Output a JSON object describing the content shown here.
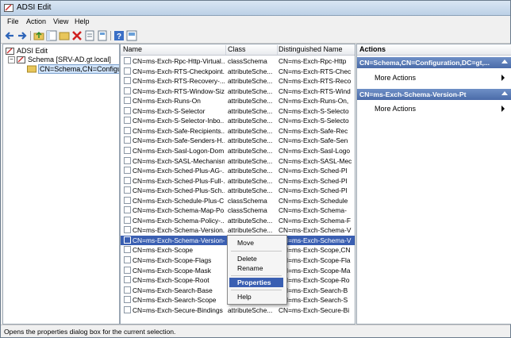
{
  "window": {
    "title": "ADSI Edit"
  },
  "menu": [
    "File",
    "Action",
    "View",
    "Help"
  ],
  "toolbar_icons": [
    "back-icon",
    "forward-icon",
    "up-folder-icon",
    "show-tree-icon",
    "delete-icon",
    "export-icon",
    "properties-icon",
    "help-icon",
    "console-icon"
  ],
  "tree": {
    "root": "ADSI Edit",
    "schema": "Schema [SRV-AD.gt.local]",
    "child": "CN=Schema,CN=Configura"
  },
  "list": {
    "headers": [
      "Name",
      "Class",
      "Distinguished Name"
    ],
    "rows": [
      {
        "name": "CN=ms-Exch-Rpc-Http-Virtual...",
        "class": "classSchema",
        "dn": "CN=ms-Exch-Rpc-Http"
      },
      {
        "name": "CN=ms-Exch-RTS-Checkpoint...",
        "class": "attributeSche...",
        "dn": "CN=ms-Exch-RTS-Chec"
      },
      {
        "name": "CN=ms-Exch-RTS-Recovery-...",
        "class": "attributeSche...",
        "dn": "CN=ms-Exch-RTS-Reco"
      },
      {
        "name": "CN=ms-Exch-RTS-Window-Size",
        "class": "attributeSche...",
        "dn": "CN=ms-Exch-RTS-Wind"
      },
      {
        "name": "CN=ms-Exch-Runs-On",
        "class": "attributeSche...",
        "dn": "CN=ms-Exch-Runs-On,"
      },
      {
        "name": "CN=ms-Exch-S-Selector",
        "class": "attributeSche...",
        "dn": "CN=ms-Exch-S-Selecto"
      },
      {
        "name": "CN=ms-Exch-S-Selector-Inbo...",
        "class": "attributeSche...",
        "dn": "CN=ms-Exch-S-Selecto"
      },
      {
        "name": "CN=ms-Exch-Safe-Recipients...",
        "class": "attributeSche...",
        "dn": "CN=ms-Exch-Safe-Rec"
      },
      {
        "name": "CN=ms-Exch-Safe-Senders-H...",
        "class": "attributeSche...",
        "dn": "CN=ms-Exch-Safe-Sen"
      },
      {
        "name": "CN=ms-Exch-Sasl-Logon-Dom...",
        "class": "attributeSche...",
        "dn": "CN=ms-Exch-Sasl-Logo"
      },
      {
        "name": "CN=ms-Exch-SASL-Mechanisms",
        "class": "attributeSche...",
        "dn": "CN=ms-Exch-SASL-Mec"
      },
      {
        "name": "CN=ms-Exch-Sched-Plus-AG-...",
        "class": "attributeSche...",
        "dn": "CN=ms-Exch-Sched-Pl"
      },
      {
        "name": "CN=ms-Exch-Sched-Plus-Full-...",
        "class": "attributeSche...",
        "dn": "CN=ms-Exch-Sched-Pl"
      },
      {
        "name": "CN=ms-Exch-Sched-Plus-Sch...",
        "class": "attributeSche...",
        "dn": "CN=ms-Exch-Sched-Pl"
      },
      {
        "name": "CN=ms-Exch-Schedule-Plus-C...",
        "class": "classSchema",
        "dn": "CN=ms-Exch-Schedule"
      },
      {
        "name": "CN=ms-Exch-Schema-Map-Po...",
        "class": "classSchema",
        "dn": "CN=ms-Exch-Schema-"
      },
      {
        "name": "CN=ms-Exch-Schema-Policy-...",
        "class": "attributeSche...",
        "dn": "CN=ms-Exch-Schema-F"
      },
      {
        "name": "CN=ms-Exch-Schema-Version...",
        "class": "attributeSche...",
        "dn": "CN=ms-Exch-Schema-V"
      },
      {
        "name": "CN=ms-Exch-Schema-Version-Pt",
        "class": "attributeSche...",
        "dn": "CN=ms-Exch-Schema-V"
      },
      {
        "name": "CN=ms-Exch-Scope",
        "class": "attributeSche...",
        "dn": "CN=ms-Exch-Scope,CN"
      },
      {
        "name": "CN=ms-Exch-Scope-Flags",
        "class": "attributeSche...",
        "dn": "CN=ms-Exch-Scope-Fla"
      },
      {
        "name": "CN=ms-Exch-Scope-Mask",
        "class": "attributeSche...",
        "dn": "CN=ms-Exch-Scope-Ma"
      },
      {
        "name": "CN=ms-Exch-Scope-Root",
        "class": "attributeSche...",
        "dn": "CN=ms-Exch-Scope-Ro"
      },
      {
        "name": "CN=ms-Exch-Search-Base",
        "class": "attributeSche...",
        "dn": "CN=ms-Exch-Search-B"
      },
      {
        "name": "CN=ms-Exch-Search-Scope",
        "class": "attributeSche...",
        "dn": "CN=ms-Exch-Search-S"
      },
      {
        "name": "CN=ms-Exch-Secure-Bindings",
        "class": "attributeSche...",
        "dn": "CN=ms-Exch-Secure-Bi"
      }
    ]
  },
  "context_menu": {
    "move": "Move",
    "delete": "Delete",
    "rename": "Rename",
    "properties": "Properties",
    "help": "Help"
  },
  "actions": {
    "header": "Actions",
    "sections": [
      {
        "title": "CN=Schema,CN=Configuration,DC=gt,...",
        "item": "More Actions"
      },
      {
        "title": "CN=ms-Exch-Schema-Version-Pt",
        "item": "More Actions"
      }
    ]
  },
  "status": "Opens the properties dialog box for the current selection.",
  "colors": {
    "selection": "#3a5fb2",
    "section_header": "#4a6ba9"
  }
}
